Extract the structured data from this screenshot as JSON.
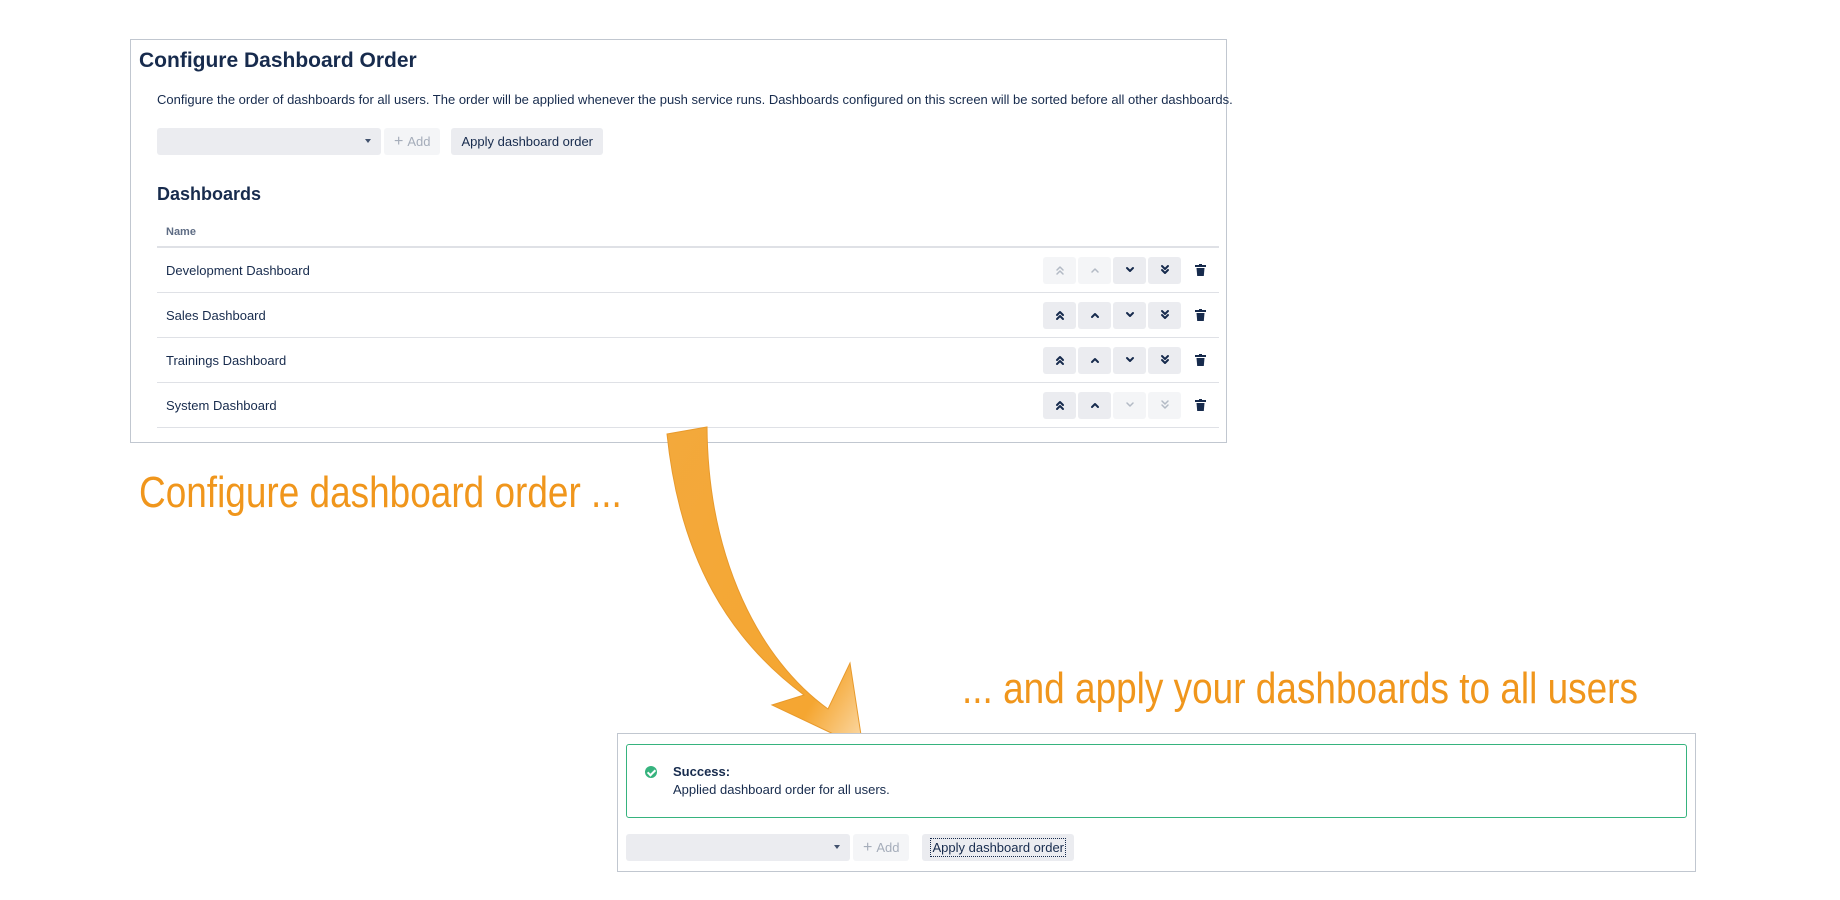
{
  "config_panel": {
    "title": "Configure Dashboard Order",
    "description": "Configure the order of dashboards for all users. The order will be applied whenever the push service runs. Dashboards configured on this screen will be sorted before all other dashboards.",
    "toolbar": {
      "select_value": "",
      "add_label": "Add",
      "apply_label": "Apply dashboard order"
    },
    "section_title": "Dashboards",
    "table": {
      "column_name": "Name",
      "rows": [
        {
          "name": "Development Dashboard"
        },
        {
          "name": "Sales Dashboard"
        },
        {
          "name": "Trainings Dashboard"
        },
        {
          "name": "System Dashboard"
        }
      ]
    }
  },
  "captions": {
    "first": "Configure dashboard order ...",
    "second": "... and apply your dashboards to all users"
  },
  "result_panel": {
    "success_title": "Success:",
    "success_message": "Applied dashboard order for all users.",
    "toolbar": {
      "select_value": "",
      "add_label": "Add",
      "apply_label": "Apply dashboard order"
    }
  },
  "colors": {
    "accent_orange": "#f0961c",
    "success_green": "#36b37e",
    "text_dark": "#172b4d"
  },
  "icons": {
    "move_top": "double-chevron-up-icon",
    "move_up": "chevron-up-icon",
    "move_down": "chevron-down-icon",
    "move_bottom": "double-chevron-down-icon",
    "delete": "trash-icon",
    "success": "check-circle-icon"
  }
}
